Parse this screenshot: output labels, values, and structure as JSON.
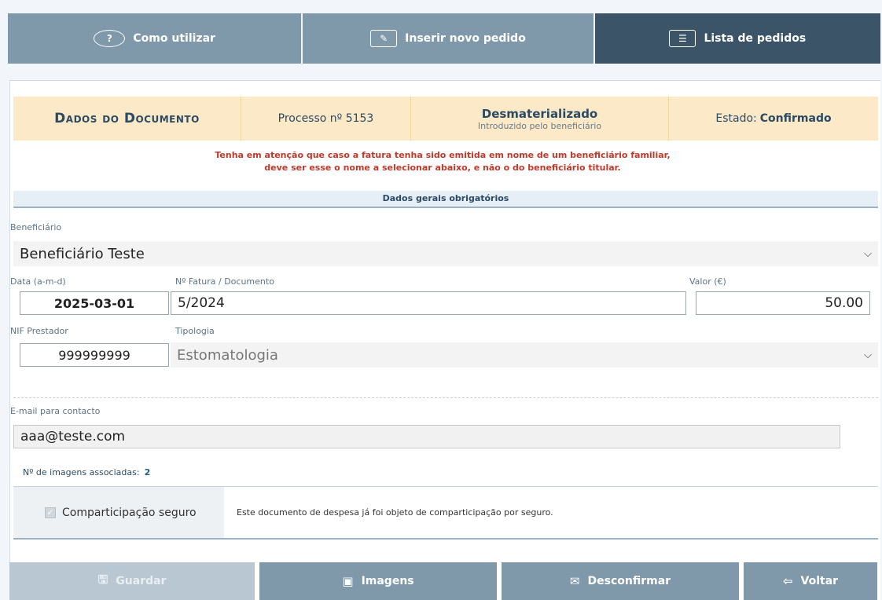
{
  "tabs": [
    {
      "label": "Como utilizar",
      "icon": "question-icon",
      "glyph": "?"
    },
    {
      "label": "Inserir novo pedido",
      "icon": "edit-icon",
      "glyph": "✎"
    },
    {
      "label": "Lista de pedidos",
      "icon": "list-icon",
      "glyph": "☰"
    }
  ],
  "header": {
    "title": "Dados do Documento",
    "processo": "Processo nº 5153",
    "desm_title": "Desmaterializado",
    "desm_sub": "Introduzido pelo beneficiário",
    "estado_label": "Estado:",
    "estado_value": "Confirmado"
  },
  "warning": {
    "line1": "Tenha em atenção que caso a fatura tenha sido emitida em nome de um beneficiário familiar,",
    "line2": "deve ser esse o nome a selecionar abaixo, e não o do beneficiário titular."
  },
  "section_title": "Dados gerais obrigatórios",
  "form": {
    "beneficiario_label": "Beneficiário",
    "beneficiario_value": "Beneficiário Teste",
    "data_label": "Data (a-m-d)",
    "data_value": "2025-03-01",
    "fatura_label": "Nº Fatura / Documento",
    "fatura_value": "5/2024",
    "valor_label": "Valor (€)",
    "valor_value": "50.00",
    "nif_label": "NIF Prestador",
    "nif_value": "999999999",
    "tipologia_label": "Tipologia",
    "tipologia_value": "Estomatologia",
    "email_label": "E-mail para contacto",
    "email_value": "aaa@teste.com",
    "imagens_label": "Nº de imagens associadas:",
    "imagens_value": "2"
  },
  "seguro": {
    "checkbox_label": "Comparticipação seguro",
    "checked": true,
    "note": "Este documento de despesa já foi objeto de comparticipação por seguro."
  },
  "buttons": {
    "guardar": "Guardar",
    "imagens": "Imagens",
    "desconfirmar": "Desconfirmar",
    "voltar": "Voltar"
  }
}
